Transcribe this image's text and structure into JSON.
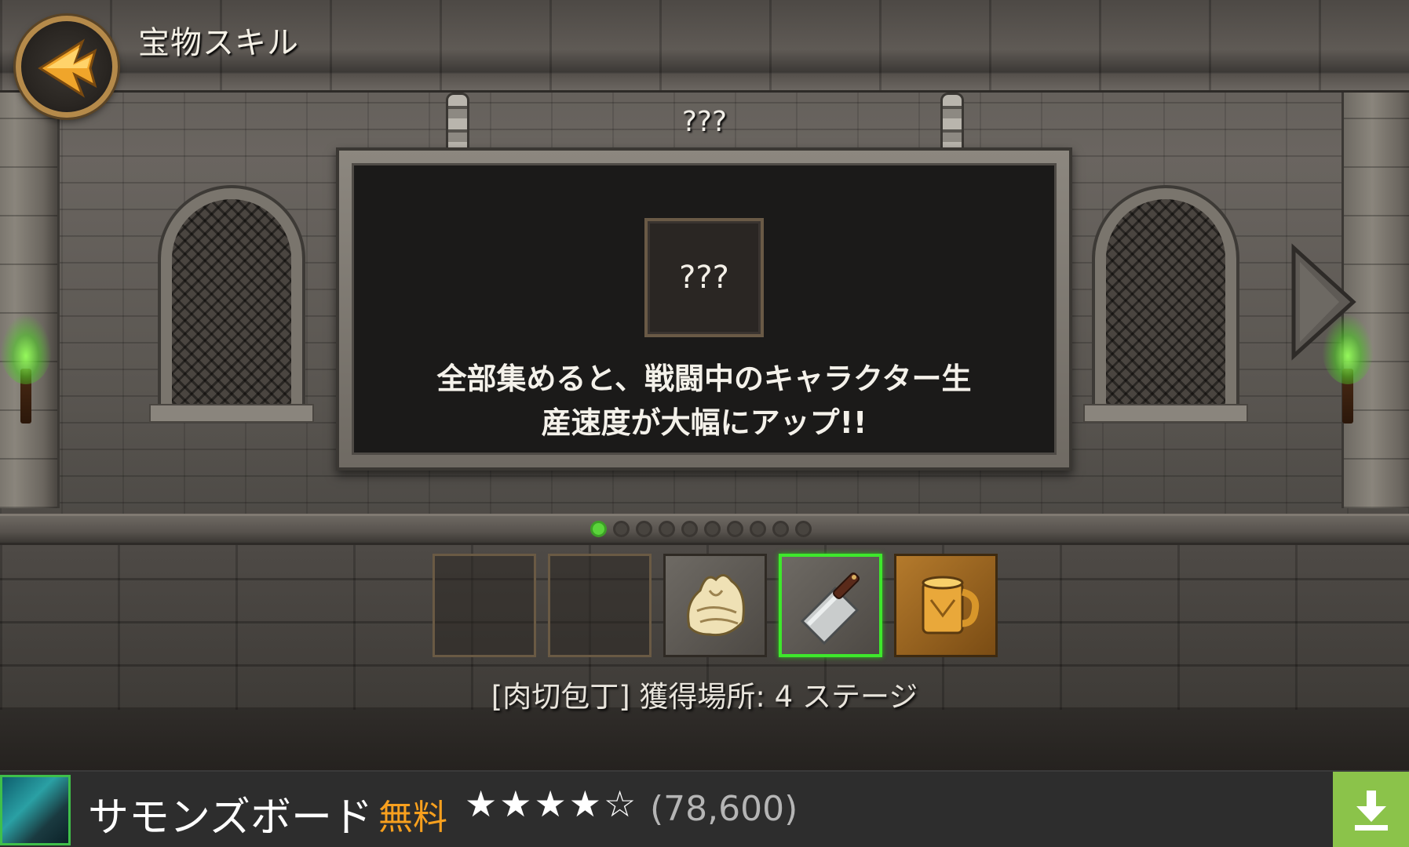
{
  "header": {
    "title": "宝物スキル",
    "back_icon": "back-arrow-icon"
  },
  "panel": {
    "header": "???",
    "mystery_label": "???",
    "description_line1": "全部集めると、戦闘中のキャラクター生",
    "description_line2": "産速度が大幅にアップ!!"
  },
  "navigation": {
    "next_icon": "chevron-right-icon",
    "page_count": 10,
    "current_page": 1
  },
  "items": [
    {
      "state": "empty",
      "icon": "empty-slot"
    },
    {
      "state": "empty",
      "icon": "empty-slot"
    },
    {
      "state": "filled",
      "icon": "cloth-bundle-icon"
    },
    {
      "state": "selected",
      "icon": "meat-cleaver-icon"
    },
    {
      "state": "filled",
      "icon": "golden-mug-icon"
    }
  ],
  "selected_item_text": "[肉切包丁] 獲得場所: 4 ステージ",
  "ad": {
    "app_name": "サモンズボード",
    "price": "無料",
    "rating_stars": "★★★★☆",
    "rating_value": 4.5,
    "reviews": "(78,600)",
    "download_icon": "download-icon",
    "colors": {
      "price": "#f8a01e",
      "download_bg": "#8bc34a"
    }
  },
  "colors": {
    "active_dot": "#5bd43b",
    "selected_border": "#3ee82c",
    "torch_glow": "#96ff5a"
  }
}
